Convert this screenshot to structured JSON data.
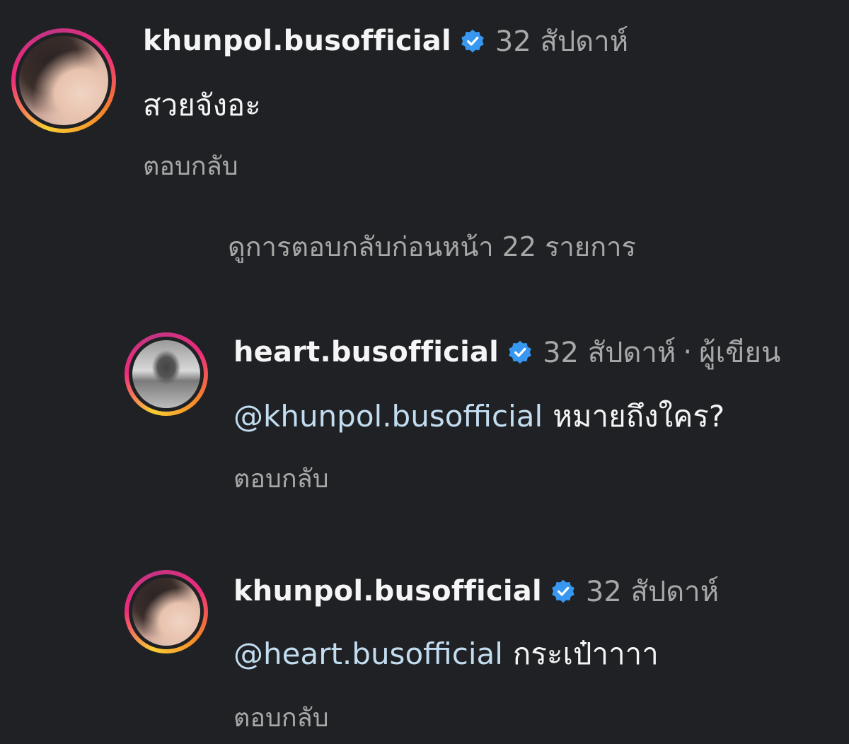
{
  "comments": [
    {
      "username": "khunpol.busofficial",
      "verified": true,
      "time": "32 สัปดาห์",
      "text": "สวยจังอะ",
      "reply_label": "ตอบกลับ"
    },
    {
      "username": "heart.busofficial",
      "verified": true,
      "time": "32 สัปดาห์",
      "separator": "·",
      "author_tag": "ผู้เขียน",
      "mention": "@khunpol.busofficial",
      "text": "หมายถึงใคร?",
      "reply_label": "ตอบกลับ"
    },
    {
      "username": "khunpol.busofficial",
      "verified": true,
      "time": "32 สัปดาห์",
      "mention": "@heart.busofficial",
      "text": "กระเป๋าาาา",
      "reply_label": "ตอบกลับ"
    }
  ],
  "view_previous_replies": "ดูการตอบกลับก่อนหน้า 22 รายการ",
  "colors": {
    "background": "#1f2124",
    "username": "#f5f5f5",
    "meta": "#a8a8a8",
    "mention": "#c2dcf0",
    "verified_badge": "#3897f0"
  },
  "icons": {
    "verified": "verified-badge-icon",
    "avatar_ring": "story-ring"
  }
}
